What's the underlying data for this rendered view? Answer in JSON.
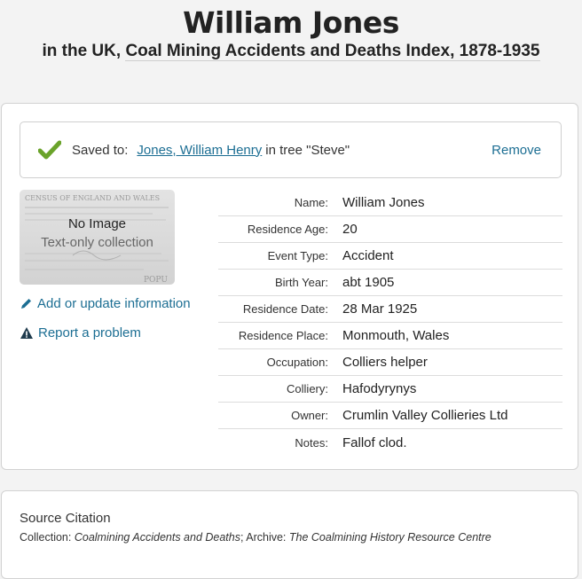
{
  "header": {
    "name": "William Jones",
    "subtitle_prefix": "in the UK, ",
    "collection_title": "Coal Mining Accidents and Deaths Index, 1878-1935"
  },
  "saved": {
    "label": "Saved to:",
    "person_link": "Jones, William Henry",
    "tree_text": "in tree \"Steve\"",
    "remove_label": "Remove"
  },
  "thumbnail": {
    "no_image": "No Image",
    "text_only": "Text-only collection",
    "census_heading": "CENSUS OF ENGLAND AND WALES",
    "census_corner": "POPU"
  },
  "actions": {
    "add_update": "Add or update information",
    "report": "Report a problem"
  },
  "facts": [
    {
      "label": "Name:",
      "value": "William Jones"
    },
    {
      "label": "Residence Age:",
      "value": "20"
    },
    {
      "label": "Event Type:",
      "value": "Accident"
    },
    {
      "label": "Birth Year:",
      "value": "abt 1905"
    },
    {
      "label": "Residence Date:",
      "value": "28 Mar 1925"
    },
    {
      "label": "Residence Place:",
      "value": "Monmouth, Wales"
    },
    {
      "label": "Occupation:",
      "value": "Colliers helper"
    },
    {
      "label": "Colliery:",
      "value": "Hafodyrynys"
    },
    {
      "label": "Owner:",
      "value": "Crumlin Valley Collieries Ltd"
    },
    {
      "label": "Notes:",
      "value": "Fallof clod."
    }
  ],
  "citation": {
    "title": "Source Citation",
    "collection_label": "Collection: ",
    "collection_value": "Coalmining Accidents and Deaths",
    "archive_label": "; Archive: ",
    "archive_value": "The Coalmining History Resource Centre"
  },
  "colors": {
    "link": "#1c6e93",
    "check": "#6aa32a",
    "background": "#f3f3f3"
  }
}
